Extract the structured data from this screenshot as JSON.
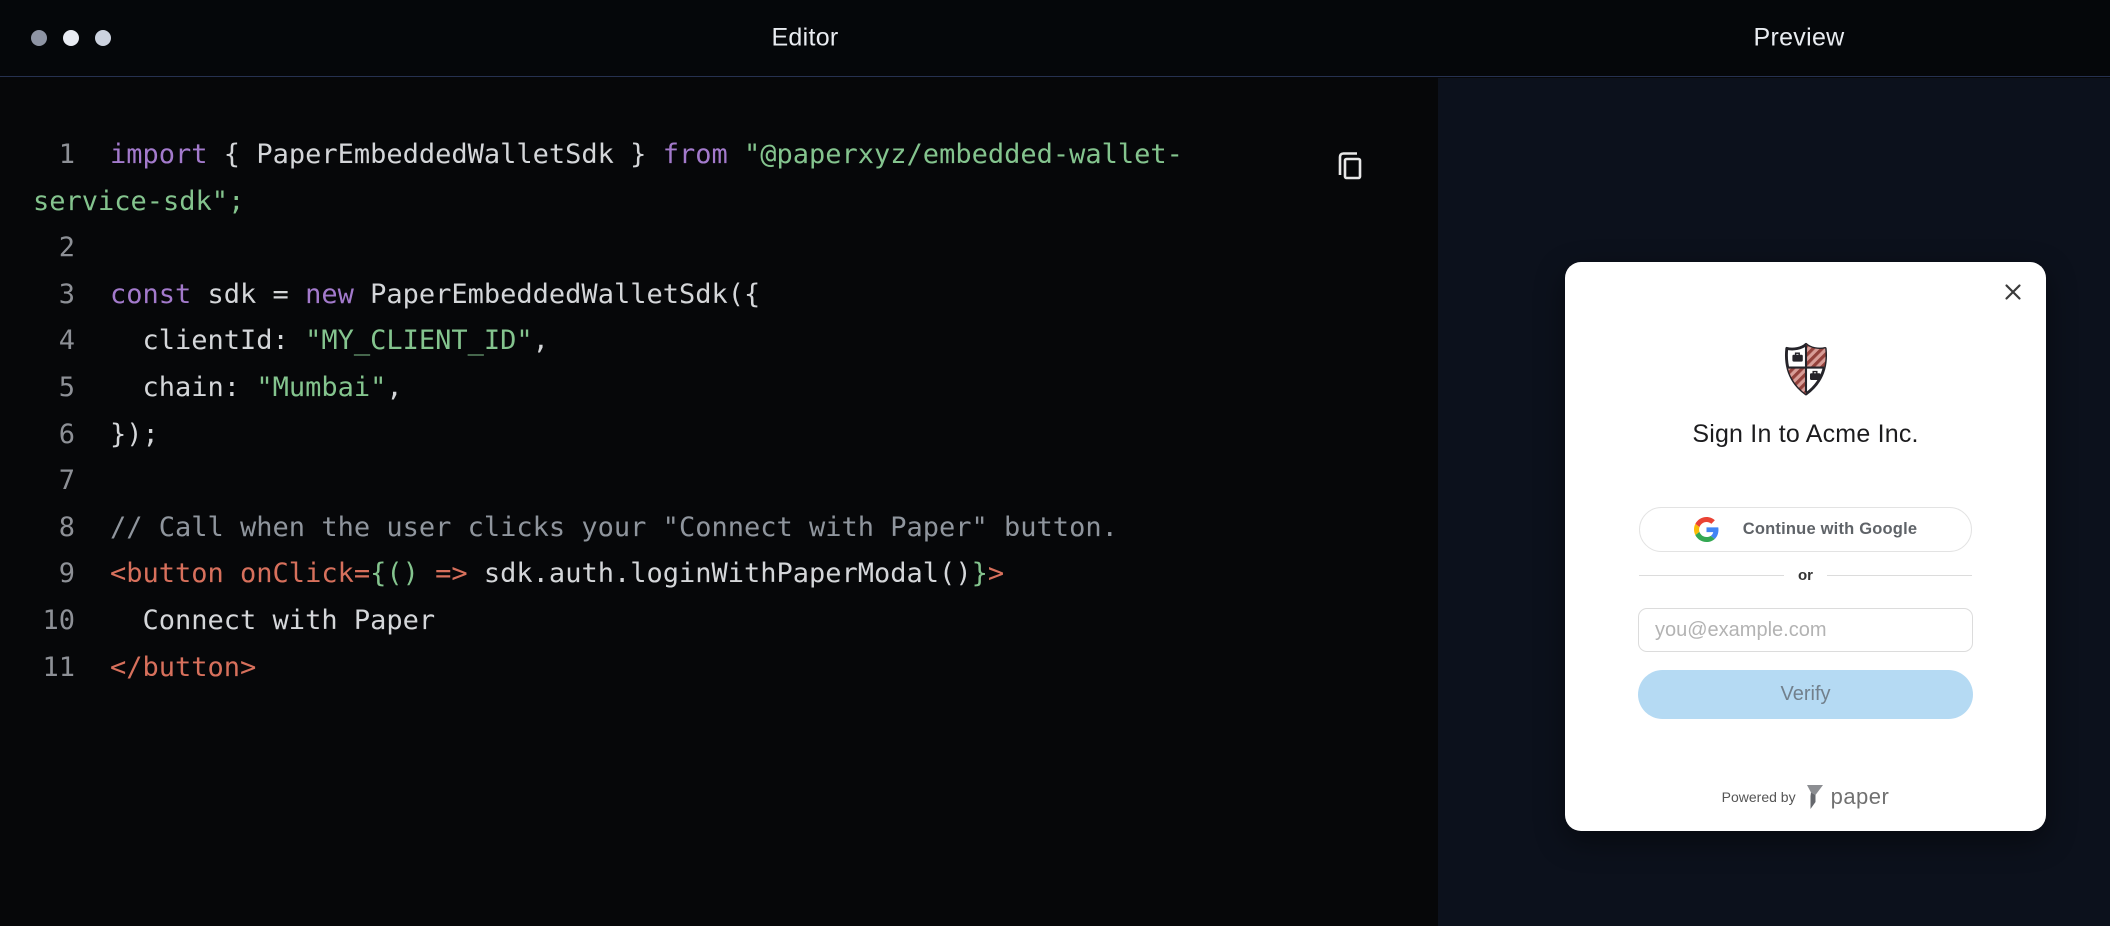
{
  "window": {
    "editor_title": "Editor",
    "preview_title": "Preview",
    "traffic_dot_colors": [
      "#8e94a4",
      "#e9ecf3",
      "#ccd2df"
    ]
  },
  "editor": {
    "copy_icon": "copy-icon",
    "code_lines": [
      {
        "num": "1",
        "tokens": [
          {
            "t": "import",
            "c": "kw"
          },
          {
            "t": " { PaperEmbeddedWalletSdk } ",
            "c": "plain"
          },
          {
            "t": "from",
            "c": "kw"
          },
          {
            "t": " ",
            "c": "plain"
          },
          {
            "t": "\"@paperxyz/embedded-wallet-",
            "c": "str"
          }
        ]
      },
      {
        "num": "",
        "tokens": [
          {
            "t": "service-sdk\";",
            "c": "str"
          }
        ]
      },
      {
        "num": "2",
        "tokens": []
      },
      {
        "num": "3",
        "tokens": [
          {
            "t": "const",
            "c": "kw"
          },
          {
            "t": " sdk = ",
            "c": "plain"
          },
          {
            "t": "new",
            "c": "kw"
          },
          {
            "t": " PaperEmbeddedWalletSdk({",
            "c": "plain"
          }
        ]
      },
      {
        "num": "4",
        "tokens": [
          {
            "t": "  clientId: ",
            "c": "plain"
          },
          {
            "t": "\"MY_CLIENT_ID\"",
            "c": "str"
          },
          {
            "t": ",",
            "c": "plain"
          }
        ]
      },
      {
        "num": "5",
        "tokens": [
          {
            "t": "  chain: ",
            "c": "plain"
          },
          {
            "t": "\"Mumbai\"",
            "c": "str"
          },
          {
            "t": ",",
            "c": "plain"
          }
        ]
      },
      {
        "num": "6",
        "tokens": [
          {
            "t": "});",
            "c": "plain"
          }
        ]
      },
      {
        "num": "7",
        "tokens": []
      },
      {
        "num": "8",
        "tokens": [
          {
            "t": "// Call when the user clicks your \"Connect with Paper\" button.",
            "c": "comment"
          }
        ]
      },
      {
        "num": "9",
        "tokens": [
          {
            "t": "<button onClick=",
            "c": "tag"
          },
          {
            "t": "{()",
            "c": "punct"
          },
          {
            "t": " ",
            "c": "plain"
          },
          {
            "t": "=>",
            "c": "tag"
          },
          {
            "t": " sdk.auth.loginWithPaperModal()",
            "c": "plain"
          },
          {
            "t": "}",
            "c": "punct"
          },
          {
            "t": ">",
            "c": "tag"
          }
        ]
      },
      {
        "num": "10",
        "tokens": [
          {
            "t": "  Connect with Paper",
            "c": "plain"
          }
        ]
      },
      {
        "num": "11",
        "tokens": [
          {
            "t": "</button>",
            "c": "tag"
          }
        ]
      }
    ]
  },
  "modal": {
    "close_icon": "close-icon",
    "logo_icon": "acme-shield-logo",
    "title": "Sign In to Acme Inc.",
    "google_icon": "google-g-icon",
    "google_label": "Continue with Google",
    "divider_label": "or",
    "email_placeholder": "you@example.com",
    "verify_label": "Verify",
    "powered_by_label": "Powered by",
    "brand_icon": "paper-logo",
    "brand_label": "paper"
  },
  "colors": {
    "topbar_bg": "#05070a",
    "topbar_border": "#263150",
    "editor_bg": "#060709",
    "preview_bg": "#0c111c",
    "card_bg": "#ffffff",
    "token_keyword": "#a37acc",
    "token_string": "#84c48e",
    "token_plain": "#d4d6d9",
    "token_comment": "#8f959d",
    "token_tag": "#d7705c",
    "line_number": "#8d9096",
    "verify_bg": "#b5daf3",
    "verify_text": "#72808c",
    "google_text": "#5f6368"
  }
}
